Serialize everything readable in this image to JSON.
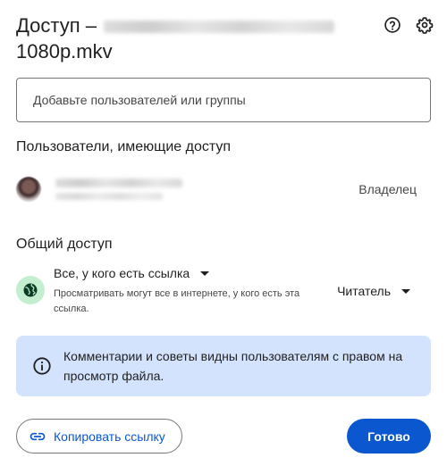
{
  "dialog": {
    "title_prefix": "Доступ –",
    "title_suffix": "1080p.mkv",
    "help_icon": "help-circle-icon",
    "settings_icon": "gear-icon"
  },
  "add_people": {
    "placeholder": "Добавьте пользователей или группы"
  },
  "people_with_access": {
    "heading": "Пользователи, имеющие доступ",
    "users": [
      {
        "role": "Владелец"
      }
    ]
  },
  "general_access": {
    "heading": "Общий доступ",
    "selected_option": "Все, у кого есть ссылка",
    "description": "Просматривать могут все в интернете, у кого есть эта ссылка.",
    "role": "Читатель",
    "icon": "globe-icon",
    "icon_bg": "#c4eed0"
  },
  "info": {
    "text": "Комментарии и советы видны пользователям с правом на просмотр файла.",
    "icon": "info-icon",
    "bg": "#d3e3fd"
  },
  "footer": {
    "copy_link_label": "Копировать ссылку",
    "done_label": "Готово",
    "accent": "#0b57d0"
  }
}
